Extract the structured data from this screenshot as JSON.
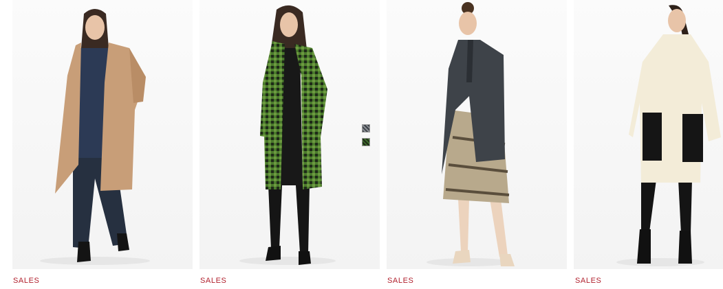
{
  "products": [
    {
      "badge": "SALES",
      "coat_color": "#c89e78",
      "figure": "camel-coat"
    },
    {
      "badge": "SALES",
      "coat_color": "#4a7a2c",
      "figure": "green-check-coat"
    },
    {
      "badge": "SALES",
      "coat_color": "#3e4349",
      "figure": "grey-coat"
    },
    {
      "badge": "SALES",
      "coat_color": "#f3ecd8",
      "figure": "cream-coat"
    }
  ],
  "swatches": [
    {
      "name": "dark-grey-pattern",
      "color": "#55585d"
    },
    {
      "name": "green-check-pattern",
      "color": "#3c6b2a"
    }
  ],
  "colors": {
    "badge": "#b01e2b",
    "background": "#ffffff"
  }
}
